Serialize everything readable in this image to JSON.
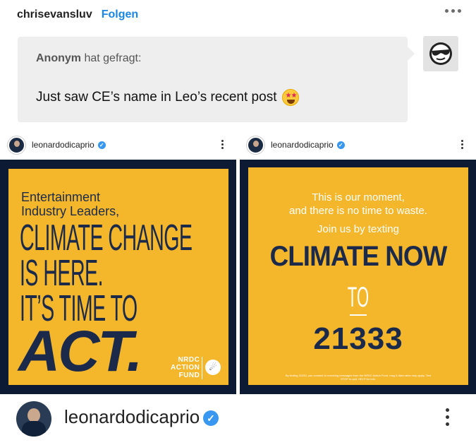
{
  "post": {
    "blog_name": "chrisevansluv",
    "follow_label": "Folgen"
  },
  "ask": {
    "asker": "Anonym",
    "asked_label": "hat gefragt:",
    "question": "Just saw CE’s name in Leo’s recent post"
  },
  "instagram": {
    "username": "leonardodicaprio",
    "verified_mark": "✓"
  },
  "graphic_left": {
    "intro_line1": "Entertainment",
    "intro_line2": "Industry Leaders,",
    "line1": "CLIMATE CHANGE",
    "line2": "IS HERE.",
    "line3": "IT’S TIME TO",
    "line4": "ACT.",
    "logo_line1": "NRDC",
    "logo_line2": "ACTION",
    "logo_line3": "FUND"
  },
  "graphic_right": {
    "line1": "This is our moment,",
    "line2": "and there is no time to waste.",
    "line3": "Join us by texting",
    "keyword": "CLIMATE NOW",
    "to": "TO",
    "number": "21333",
    "fine_print": "By texting 21333, you consent to receiving messages from the NRDC Action Fund. msg & data rates may apply. Text STOP to quit, HELP for info."
  },
  "colors": {
    "accent_link": "#1a86e6",
    "poster_gold": "#f4b72c",
    "poster_navy": "#1b2a4a",
    "verified_blue": "#3897f0"
  }
}
